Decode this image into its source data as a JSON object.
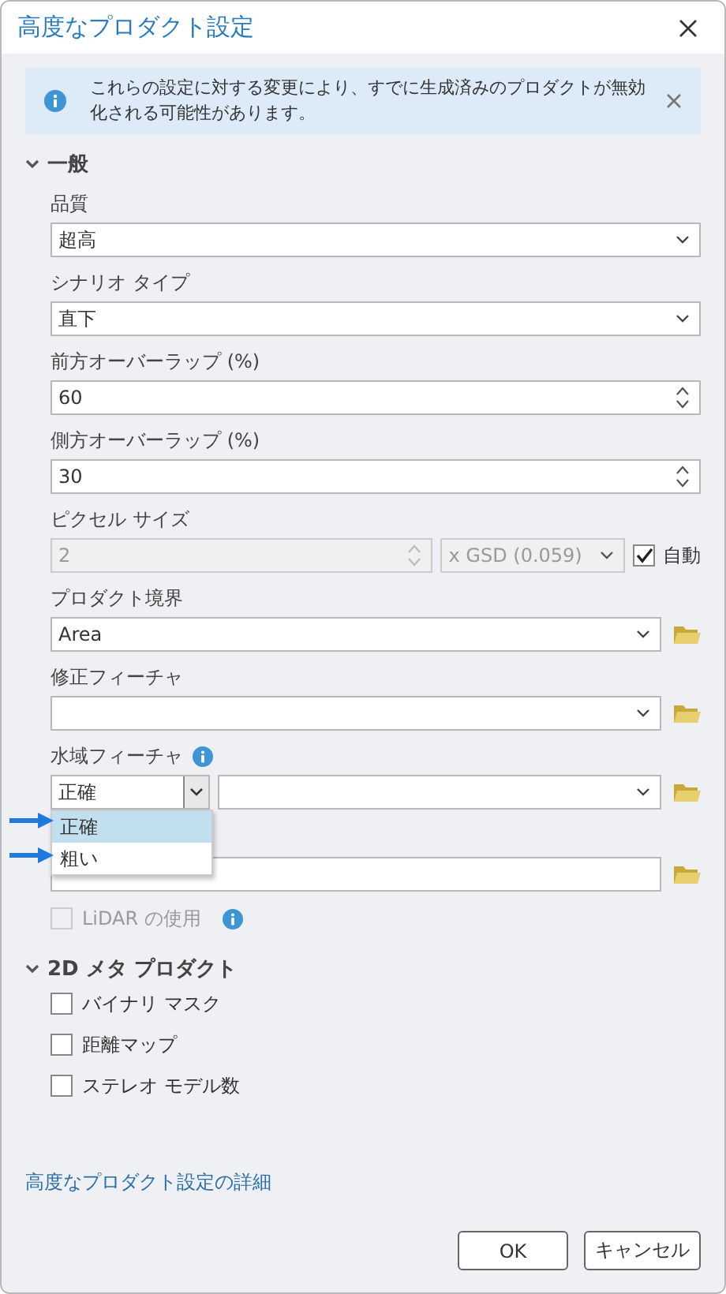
{
  "window": {
    "title": "高度なプロダクト設定"
  },
  "banner": {
    "text": "これらの設定に対する変更により、すでに生成済みのプロダクトが無効化される可能性があります。"
  },
  "sections": [
    {
      "title": "一般",
      "expanded": true,
      "items": [
        {
          "kind": "select",
          "label": "品質",
          "value": "超高"
        },
        {
          "kind": "select",
          "label": "シナリオ タイプ",
          "value": "直下"
        },
        {
          "kind": "spinner",
          "label": "前方オーバーラップ (%)",
          "value": "60"
        },
        {
          "kind": "spinner",
          "label": "側方オーバーラップ (%)",
          "value": "30"
        },
        {
          "kind": "pixel",
          "label": "ピクセル サイズ",
          "value": "2",
          "unit": "x GSD (0.059)",
          "disabled": true,
          "auto_label": "自動",
          "auto_checked": true
        },
        {
          "kind": "select_folder",
          "label": "プロダクト境界",
          "value": "Area"
        },
        {
          "kind": "select_folder",
          "label": "修正フィーチャ"
        },
        {
          "kind": "water",
          "label": "水域フィーチャ",
          "info": true,
          "value": "正確",
          "expanded": true,
          "menu": [
            {
              "label": "正確",
              "selected": true,
              "pointed": true
            },
            {
              "label": "粗い",
              "selected": false,
              "pointed": true
            }
          ]
        },
        {
          "kind": "text_folder"
        },
        {
          "kind": "checkbox",
          "label": "LiDAR の使用",
          "checked": false,
          "disabled": true,
          "info": true
        }
      ]
    },
    {
      "title": "2D メタ プロダクト",
      "expanded": true,
      "items": [
        {
          "kind": "checkbox",
          "label": "バイナリ マスク",
          "checked": false,
          "disabled": false
        },
        {
          "kind": "checkbox",
          "label": "距離マップ",
          "checked": false,
          "disabled": false
        },
        {
          "kind": "checkbox",
          "label": "ステレオ モデル数",
          "checked": false,
          "disabled": false
        }
      ]
    }
  ],
  "link": "高度なプロダクト設定の詳細",
  "buttons": [
    "OK",
    "キャンセル"
  ]
}
